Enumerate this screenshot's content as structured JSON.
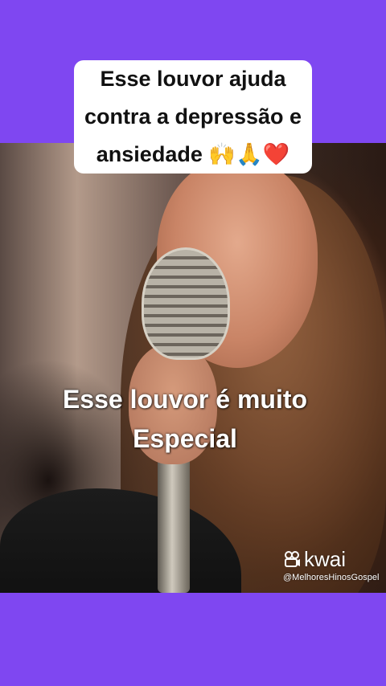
{
  "banner": {
    "text": "Esse louvor ajuda contra a depressão e ansiedade 🙌🙏❤️"
  },
  "video": {
    "caption": "Esse louvor é muito\nEspecial"
  },
  "watermark": {
    "brand": "kwai",
    "handle": "@MelhoresHinosGospel"
  },
  "colors": {
    "background": "#7f47f1",
    "banner_bg": "#ffffff"
  }
}
